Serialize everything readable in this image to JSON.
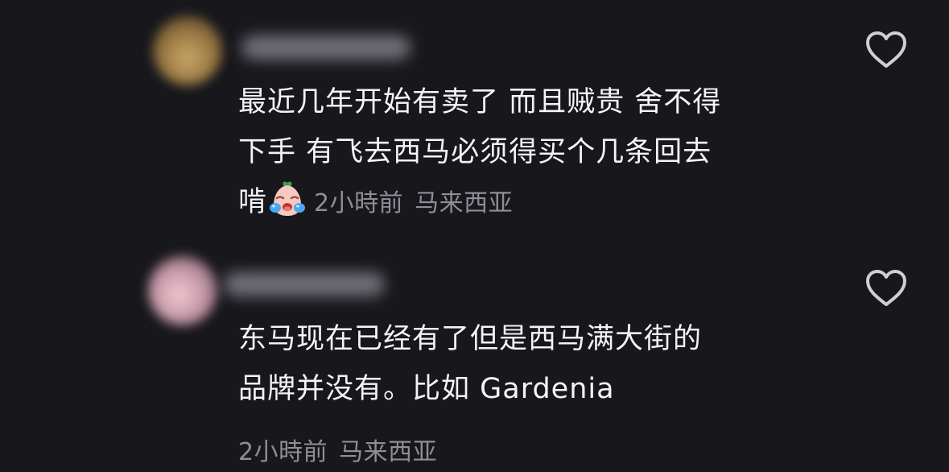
{
  "comments": [
    {
      "username": "",
      "lines": [
        "最近几年开始有卖了 而且贼贵 舍不得",
        "下手 有飞去西马必须得买个几条回去",
        "啃"
      ],
      "emoji_icon": "crying-face-emoji-icon",
      "time": "2小時前",
      "location": "马来西亚",
      "liked": false
    },
    {
      "username": "",
      "lines": [
        "东马现在已经有了但是西马满大街的",
        "品牌并没有。比如 Gardenia"
      ],
      "time": "2小時前",
      "location": "马来西亚",
      "liked": false
    }
  ],
  "colors": {
    "background": "#17171c",
    "text": "#f4f4f6",
    "meta": "#8e8e96",
    "heart": "#cfcfd4"
  }
}
